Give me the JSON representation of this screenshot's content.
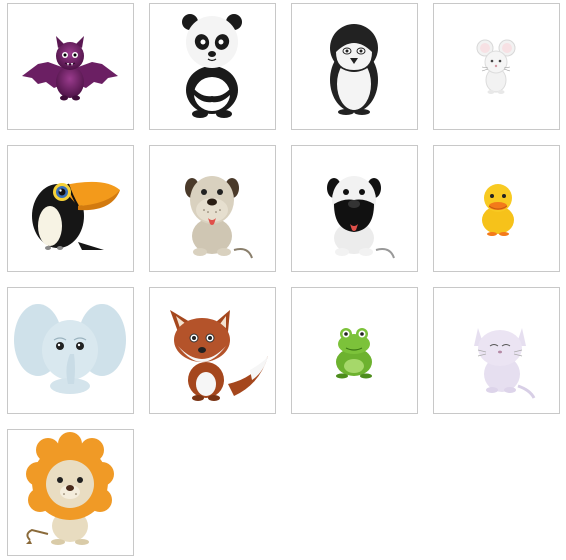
{
  "gallery": {
    "tiles": [
      {
        "animal": "bat",
        "icon": "bat-icon",
        "color": "#6b1f63"
      },
      {
        "animal": "panda",
        "icon": "panda-icon",
        "color": "#1a1a1a"
      },
      {
        "animal": "penguin",
        "icon": "penguin-icon",
        "color": "#222222"
      },
      {
        "animal": "mouse",
        "icon": "mouse-icon",
        "color": "#f2f2f2"
      },
      {
        "animal": "toucan",
        "icon": "toucan-icon",
        "color": "#f39a1b"
      },
      {
        "animal": "dog",
        "icon": "dog-icon",
        "color": "#cfc6b3"
      },
      {
        "animal": "pug",
        "icon": "pug-icon",
        "color": "#e9e9e9"
      },
      {
        "animal": "duck",
        "icon": "duck-icon",
        "color": "#f6c21a"
      },
      {
        "animal": "elephant",
        "icon": "elephant-icon",
        "color": "#cfe1ea"
      },
      {
        "animal": "fox",
        "icon": "fox-icon",
        "color": "#a5471d"
      },
      {
        "animal": "frog",
        "icon": "frog-icon",
        "color": "#6db22f"
      },
      {
        "animal": "cat",
        "icon": "cat-icon",
        "color": "#e6dff0"
      },
      {
        "animal": "lion",
        "icon": "lion-icon",
        "color": "#f09a26"
      }
    ]
  }
}
